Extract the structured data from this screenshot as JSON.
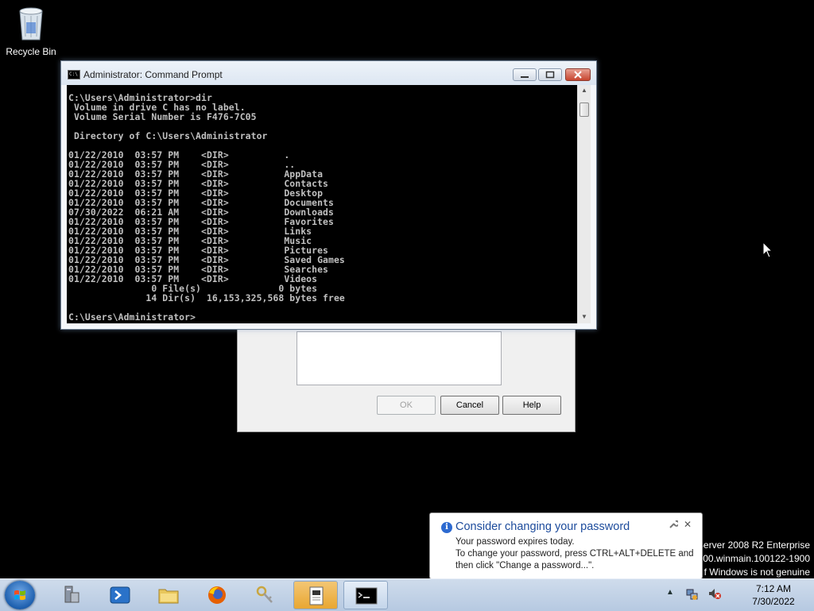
{
  "desktop": {
    "recycle_bin_label": "Recycle Bin",
    "watermark_lines": [
      "Server 2008 R2 Enterprise",
      "700.winmain.100122-1900",
      "f Windows is not genuine"
    ]
  },
  "background_dialog": {
    "ok_label": "OK",
    "cancel_label": "Cancel",
    "help_label": "Help"
  },
  "cmd_window": {
    "title": "Administrator: Command Prompt",
    "icon_text": "C:\\",
    "output": "C:\\Users\\Administrator>dir\n Volume in drive C has no label.\n Volume Serial Number is F476-7C05\n\n Directory of C:\\Users\\Administrator\n\n01/22/2010  03:57 PM    <DIR>          .\n01/22/2010  03:57 PM    <DIR>          ..\n01/22/2010  03:57 PM    <DIR>          AppData\n01/22/2010  03:57 PM    <DIR>          Contacts\n01/22/2010  03:57 PM    <DIR>          Desktop\n01/22/2010  03:57 PM    <DIR>          Documents\n07/30/2022  06:21 AM    <DIR>          Downloads\n01/22/2010  03:57 PM    <DIR>          Favorites\n01/22/2010  03:57 PM    <DIR>          Links\n01/22/2010  03:57 PM    <DIR>          Music\n01/22/2010  03:57 PM    <DIR>          Pictures\n01/22/2010  03:57 PM    <DIR>          Saved Games\n01/22/2010  03:57 PM    <DIR>          Searches\n01/22/2010  03:57 PM    <DIR>          Videos\n               0 File(s)              0 bytes\n              14 Dir(s)  16,153,325,568 bytes free\n\nC:\\Users\\Administrator>"
  },
  "notification": {
    "title": "Consider changing your password",
    "lines": [
      "Your password expires today.",
      "To change your password, press CTRL+ALT+DELETE and",
      "then click \"Change a password...\"."
    ],
    "close_glyph": "✕"
  },
  "taskbar": {
    "pinned": [
      {
        "name": "server-manager",
        "state": "pinned"
      },
      {
        "name": "powershell",
        "state": "pinned"
      },
      {
        "name": "windows-explorer",
        "state": "pinned"
      },
      {
        "name": "firefox",
        "state": "pinned"
      },
      {
        "name": "keys-tool",
        "state": "pinned"
      },
      {
        "name": "dialog-app",
        "state": "active"
      },
      {
        "name": "command-prompt",
        "state": "running"
      }
    ],
    "tray_arrow": "▲",
    "time": "7:12 AM",
    "date": "7/30/2022"
  },
  "colors": {
    "desktop_bg": "#000000",
    "balloon_title": "#1c4b9c",
    "console_text": "#c0c0c0",
    "active_taskbar_button": "#e9a732"
  }
}
